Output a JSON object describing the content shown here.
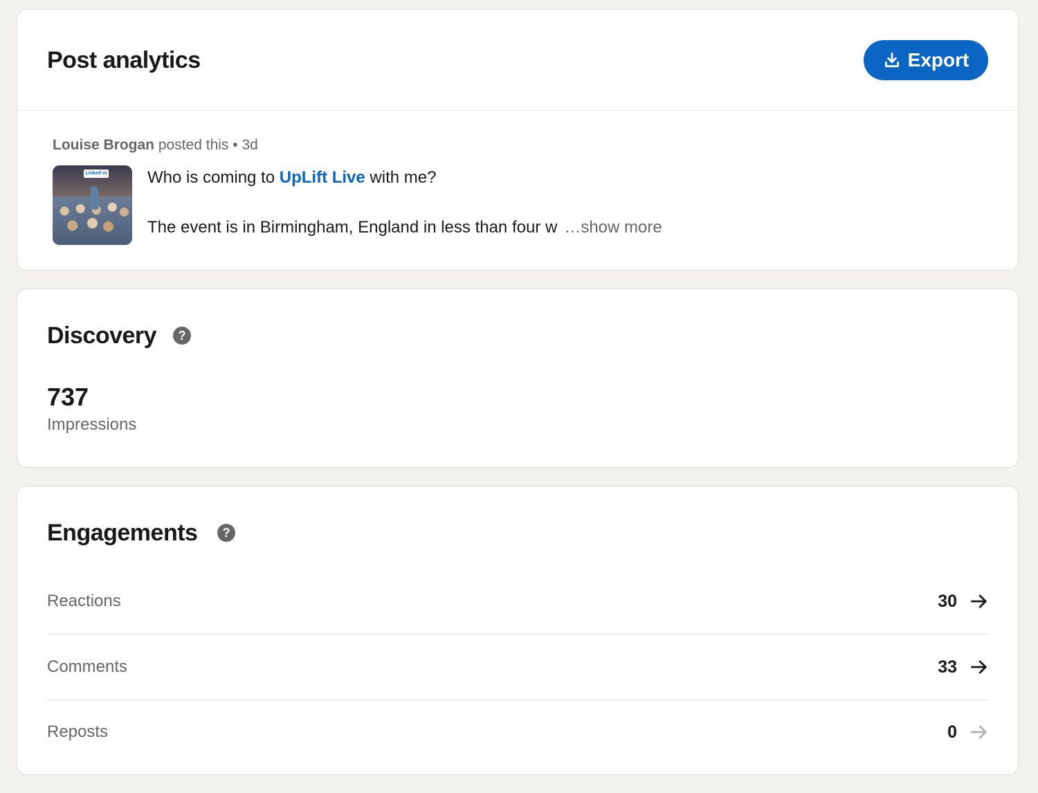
{
  "post_card": {
    "title": "Post analytics",
    "export_label": "Export",
    "author": "Louise Brogan",
    "posted_text": "posted this",
    "separator": "•",
    "age": "3d",
    "thumbnail_sign": "Linked in",
    "line1_prefix": "Who is coming to",
    "line1_mention": "UpLift Live",
    "line1_suffix": "with me?",
    "line2": "The event is in Birmingham, England in less than four w",
    "show_more": "…show more"
  },
  "discovery": {
    "title": "Discovery",
    "help": "?",
    "impressions_value": "737",
    "impressions_label": "Impressions"
  },
  "engagements": {
    "title": "Engagements",
    "help": "?",
    "rows": [
      {
        "label": "Reactions",
        "count": "30",
        "arrow_color": "#191919"
      },
      {
        "label": "Comments",
        "count": "33",
        "arrow_color": "#191919"
      },
      {
        "label": "Reposts",
        "count": "0",
        "arrow_color": "#b0b0b0"
      }
    ]
  },
  "colors": {
    "accent": "#0a66c2",
    "background": "#f3f2ef"
  }
}
